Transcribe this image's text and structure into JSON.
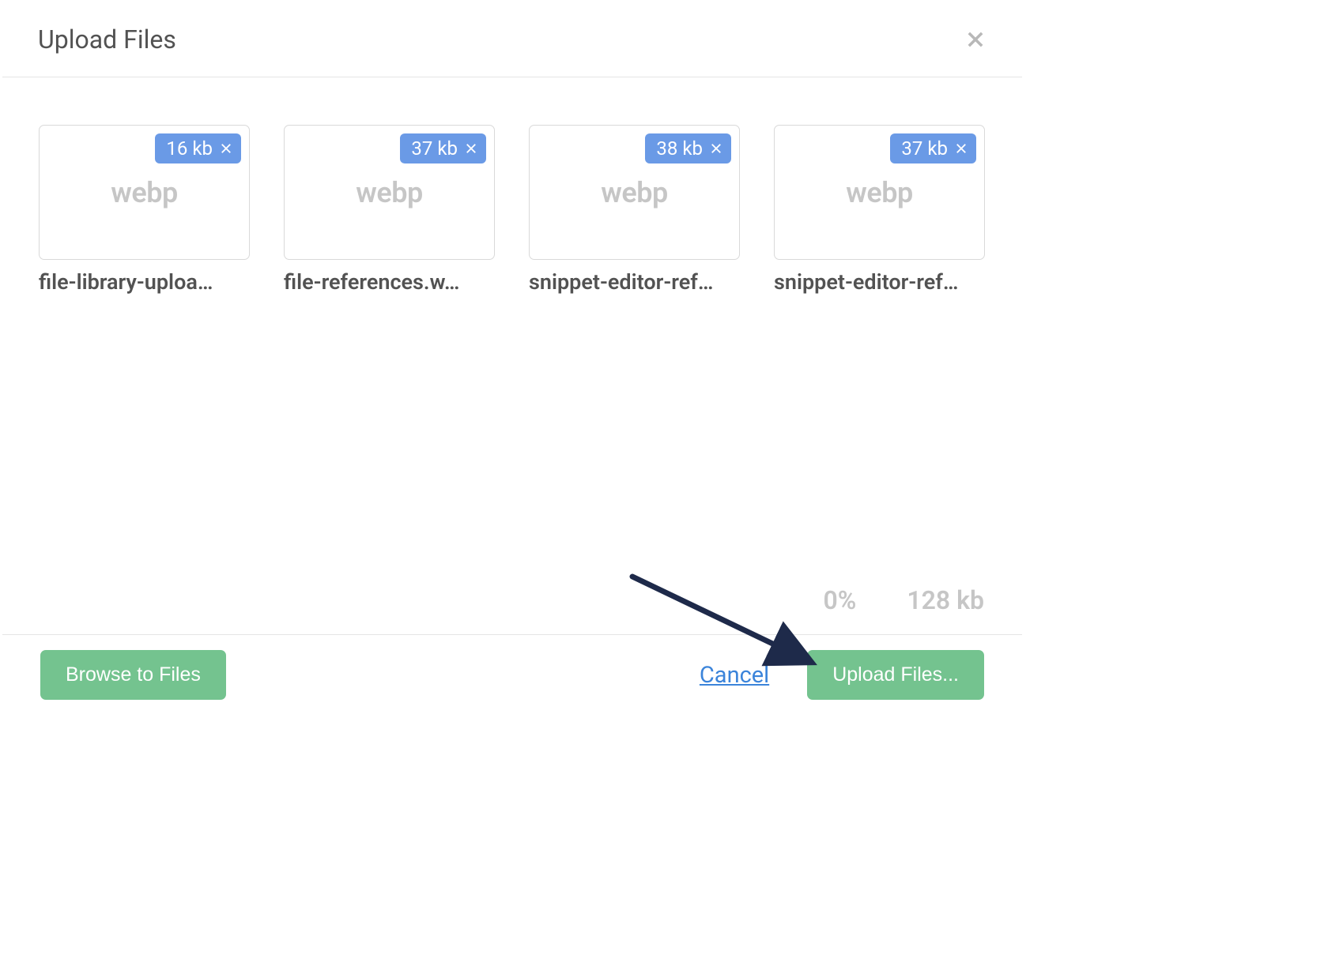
{
  "header": {
    "title": "Upload Files"
  },
  "files": [
    {
      "type_label": "webp",
      "size": "16 kb",
      "name": "file-library-uploa…"
    },
    {
      "type_label": "webp",
      "size": "37 kb",
      "name": "file-references.w…"
    },
    {
      "type_label": "webp",
      "size": "38 kb",
      "name": "snippet-editor-ref…"
    },
    {
      "type_label": "webp",
      "size": "37 kb",
      "name": "snippet-editor-ref…"
    }
  ],
  "status": {
    "percent": "0%",
    "total_size": "128 kb"
  },
  "footer": {
    "browse_label": "Browse to Files",
    "cancel_label": "Cancel",
    "upload_label": "Upload Files..."
  }
}
